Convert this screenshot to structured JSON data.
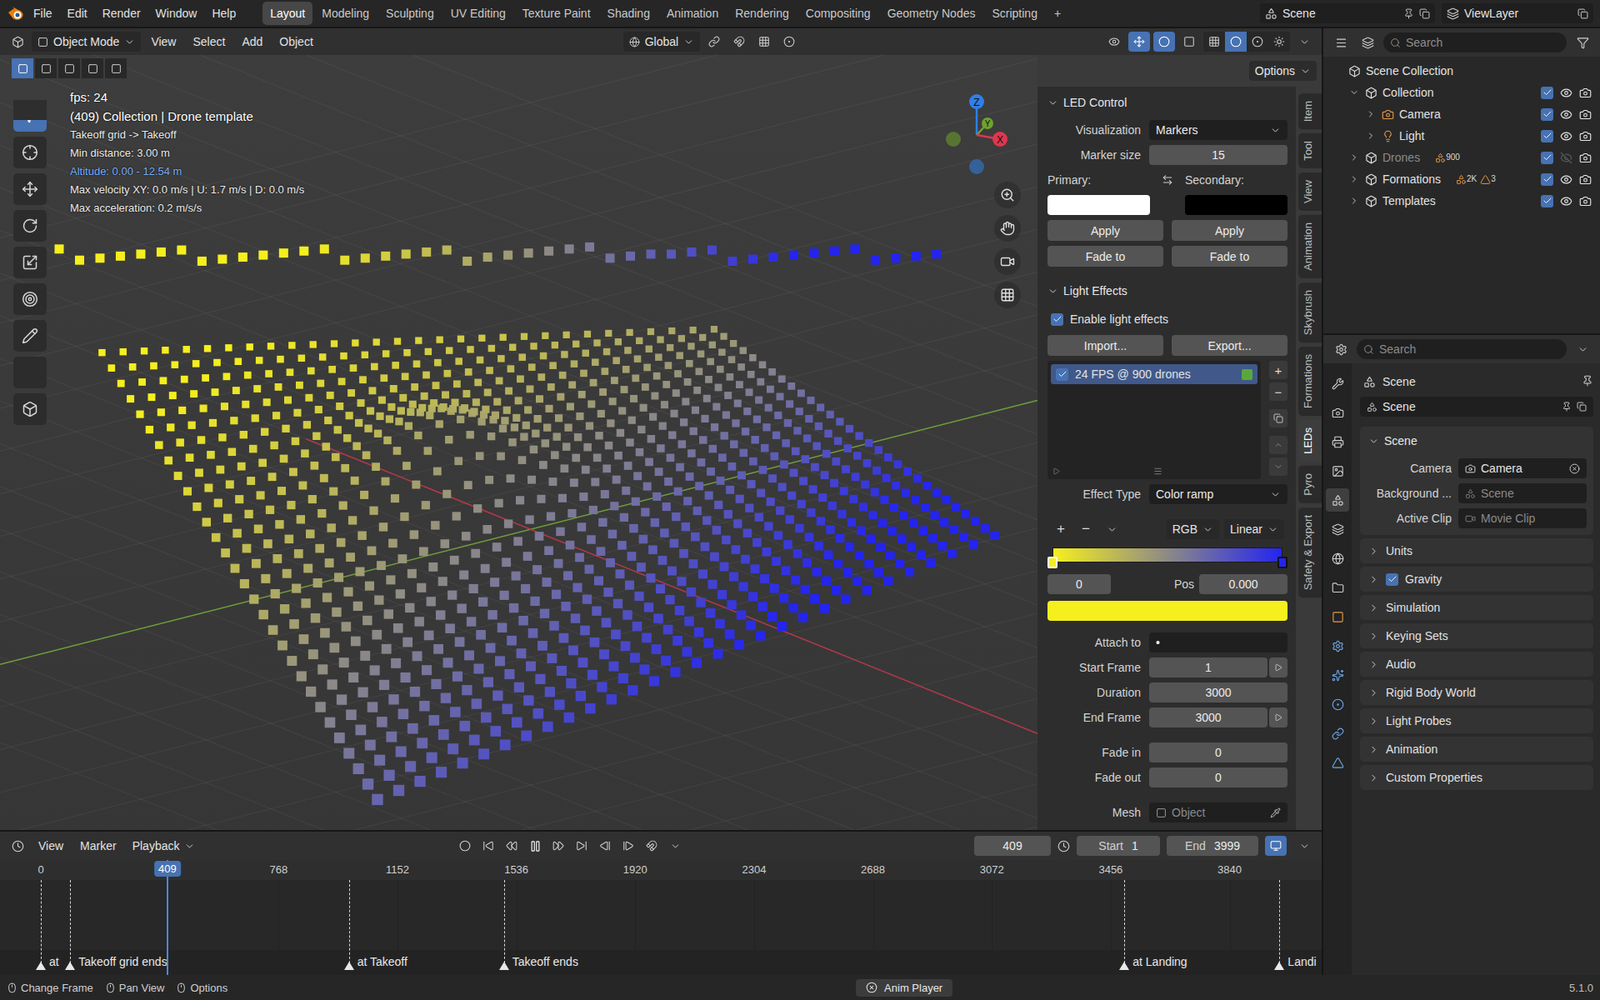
{
  "top_bar": {
    "menus": [
      "File",
      "Edit",
      "Render",
      "Window",
      "Help"
    ],
    "workspaces": [
      {
        "label": "Layout",
        "selected": true
      },
      {
        "label": "Modeling",
        "selected": false
      },
      {
        "label": "Sculpting",
        "selected": false
      },
      {
        "label": "UV Editing",
        "selected": false
      },
      {
        "label": "Texture Paint",
        "selected": false
      },
      {
        "label": "Shading",
        "selected": false
      },
      {
        "label": "Animation",
        "selected": false
      },
      {
        "label": "Rendering",
        "selected": false
      },
      {
        "label": "Compositing",
        "selected": false
      },
      {
        "label": "Geometry Nodes",
        "selected": false
      },
      {
        "label": "Scripting",
        "selected": false
      }
    ],
    "add_workspace": "+",
    "scene": "Scene",
    "view_layer": "ViewLayer"
  },
  "viewport": {
    "mode": "Object Mode",
    "menus": [
      "View",
      "Select",
      "Add",
      "Object"
    ],
    "orientation": "Global",
    "options": "Options",
    "select_modes": [
      {
        "selected": true
      },
      {
        "selected": false
      },
      {
        "selected": false
      },
      {
        "selected": false
      },
      {
        "selected": false
      }
    ],
    "tools": [
      {
        "selected": true
      },
      {
        "selected": false
      },
      {
        "selected": false
      },
      {
        "selected": false
      },
      {
        "selected": false
      },
      {
        "selected": false
      },
      {
        "selected": false
      },
      {
        "selected": false
      },
      {
        "selected": false
      }
    ],
    "shading": [
      {
        "selected": false
      },
      {
        "selected": true
      },
      {
        "selected": false
      },
      {
        "selected": false
      }
    ],
    "gizmos_on": true,
    "overlays_on": true,
    "overlay_lines": [
      {
        "text": "fps: 24",
        "kind": "title"
      },
      {
        "text": "(409) Collection | Drone template",
        "kind": "title"
      },
      {
        "text": "Takeoff grid -> Takeoff",
        "kind": "info"
      },
      {
        "text": "Min distance: 3.00 m",
        "kind": "info"
      },
      {
        "text": "Altitude: 0.00 - 12.54 m",
        "kind": "highlight"
      },
      {
        "text": "Max velocity XY: 0.0 m/s | U: 1.7 m/s | D: 0.0 m/s",
        "kind": "info"
      },
      {
        "text": "Max acceleration: 0.2 m/s/s",
        "kind": "info"
      }
    ],
    "gizmo_axes": [
      {
        "label": "Z",
        "color": "#2f7fe6"
      },
      {
        "label": "Y",
        "color": "#6fa22c"
      },
      {
        "label": "X",
        "color": "#e0364f"
      }
    ],
    "side_tabs": [
      {
        "label": "Item",
        "selected": false
      },
      {
        "label": "Tool",
        "selected": false
      },
      {
        "label": "View",
        "selected": false
      },
      {
        "label": "Animation",
        "selected": false
      },
      {
        "label": "Skybrush",
        "selected": false
      },
      {
        "label": "Formations",
        "selected": false
      },
      {
        "label": "LEDs",
        "selected": true
      },
      {
        "label": "Pyro",
        "selected": false
      },
      {
        "label": "Safety & Export",
        "selected": false
      }
    ]
  },
  "led_control": {
    "title": "LED Control",
    "expanded": true,
    "visualization_label": "Visualization",
    "visualization": "Markers",
    "marker_size_label": "Marker size",
    "marker_size": "15",
    "primary_label": "Primary:",
    "secondary_label": "Secondary:",
    "primary_color": "#ffffff",
    "secondary_color": "#000000",
    "button_rows": [
      [
        "Apply",
        "Apply"
      ],
      [
        "Fade to",
        "Fade to"
      ]
    ]
  },
  "light_effects": {
    "title": "Light Effects",
    "expanded": true,
    "enable": {
      "label": "Enable light effects",
      "checked": true
    },
    "import": "Import...",
    "export": "Export...",
    "effects": [
      {
        "label": "24 FPS @ 900 drones",
        "checked": true,
        "selected": true,
        "color": "#5aa83c"
      }
    ],
    "list_add": "+",
    "list_remove": "−",
    "effect_type_label": "Effect Type",
    "effect_type": "Color ramp",
    "ramp": {
      "add": "+",
      "remove": "−",
      "color_mode": "RGB",
      "interpolation": "Linear",
      "stops": [
        {
          "color": "#f5ef1e",
          "level": 0,
          "selected": true
        },
        {
          "color": "#2424f0",
          "level": 1,
          "selected": false
        }
      ],
      "index": "0",
      "pos_label": "Pos",
      "pos": "0.000"
    },
    "fields": [
      {
        "label": "Attach to",
        "value": "•",
        "kind": "text"
      },
      {
        "label": "Start Frame",
        "value": "1",
        "kind": "frame"
      },
      {
        "label": "Duration",
        "value": "3000",
        "kind": "number"
      },
      {
        "label": "End Frame",
        "value": "3000",
        "kind": "frame"
      },
      {
        "label": "Fade in",
        "value": "0",
        "kind": "number"
      },
      {
        "label": "Fade out",
        "value": "0",
        "kind": "number"
      },
      {
        "label": "Mesh",
        "value": "Object",
        "kind": "object"
      }
    ]
  },
  "outliner": {
    "search_placeholder": "Search",
    "items": [
      {
        "label": "Scene Collection",
        "depth": 0,
        "kind": "scene",
        "expandable": false,
        "expanded": true,
        "toggles": false,
        "checked": true,
        "visible": true,
        "disabled": false,
        "badges": []
      },
      {
        "label": "Collection",
        "depth": 1,
        "kind": "collection",
        "expandable": true,
        "expanded": true,
        "toggles": true,
        "checked": true,
        "visible": true,
        "disabled": false,
        "badges": []
      },
      {
        "label": "Camera",
        "depth": 2,
        "kind": "camera",
        "expandable": true,
        "expanded": false,
        "toggles": true,
        "checked": true,
        "visible": true,
        "disabled": false,
        "badges": []
      },
      {
        "label": "Light",
        "depth": 2,
        "kind": "light",
        "expandable": true,
        "expanded": false,
        "toggles": true,
        "checked": true,
        "visible": true,
        "disabled": false,
        "badges": []
      },
      {
        "label": "Drones",
        "depth": 1,
        "kind": "collection",
        "expandable": true,
        "expanded": false,
        "toggles": true,
        "checked": true,
        "visible": false,
        "disabled": true,
        "badges": [
          "900"
        ]
      },
      {
        "label": "Formations",
        "depth": 1,
        "kind": "collection",
        "expandable": true,
        "expanded": false,
        "toggles": true,
        "checked": true,
        "visible": true,
        "disabled": false,
        "badges": [
          "2K",
          "3"
        ]
      },
      {
        "label": "Templates",
        "depth": 1,
        "kind": "collection",
        "expandable": true,
        "expanded": false,
        "toggles": true,
        "checked": true,
        "visible": true,
        "disabled": false,
        "badges": []
      }
    ]
  },
  "properties": {
    "search_placeholder": "Search",
    "context": "Scene",
    "scene_field": "Scene",
    "tabs": [
      {
        "selected": false
      },
      {
        "selected": false
      },
      {
        "selected": false
      },
      {
        "selected": false
      },
      {
        "selected": true
      },
      {
        "selected": false
      },
      {
        "selected": false
      },
      {
        "selected": false
      },
      {
        "selected": false
      },
      {
        "selected": false
      },
      {
        "selected": false
      },
      {
        "selected": false
      },
      {
        "selected": false
      },
      {
        "selected": false
      }
    ],
    "panel": {
      "title": "Scene",
      "expanded": true,
      "rows": [
        {
          "label": "Camera",
          "value": "Camera",
          "disabled": false
        },
        {
          "label": "Background ...",
          "value": "Scene",
          "disabled": true
        },
        {
          "label": "Active Clip",
          "value": "Movie Clip",
          "disabled": true
        }
      ]
    },
    "sections": [
      {
        "label": "Units",
        "kind": "plain",
        "checked": false
      },
      {
        "label": "Gravity",
        "kind": "checkbox",
        "checked": true
      },
      {
        "label": "Simulation",
        "kind": "plain",
        "checked": false
      },
      {
        "label": "Keying Sets",
        "kind": "plain",
        "checked": false
      },
      {
        "label": "Audio",
        "kind": "plain",
        "checked": false
      },
      {
        "label": "Rigid Body World",
        "kind": "plain",
        "checked": false
      },
      {
        "label": "Light Probes",
        "kind": "plain",
        "checked": false
      },
      {
        "label": "Animation",
        "kind": "plain",
        "checked": false
      },
      {
        "label": "Custom Properties",
        "kind": "plain",
        "checked": false
      }
    ]
  },
  "timeline": {
    "menus": [
      "View",
      "Marker"
    ],
    "playback": "Playback",
    "playing": true,
    "current_frame": "409",
    "start_label": "Start",
    "start": "1",
    "end_label": "End",
    "end": "3999",
    "ticks": [
      "0",
      "768",
      "1152",
      "1536",
      "1920",
      "2304",
      "2688",
      "3072",
      "3456",
      "3840"
    ],
    "markers": [
      {
        "label": "at",
        "frame": 0
      },
      {
        "label": "Takeoff grid ends",
        "frame": 95
      },
      {
        "label": "at Takeoff",
        "frame": 995
      },
      {
        "label": "Takeoff ends",
        "frame": 1496
      },
      {
        "label": "at Landing",
        "frame": 3500
      },
      {
        "label": "Landi",
        "frame": 4001
      }
    ]
  },
  "status_bar": {
    "items": [
      "Change Frame",
      "Pan View",
      "Options"
    ],
    "center": "Anim Player",
    "version": "5.1.0"
  }
}
